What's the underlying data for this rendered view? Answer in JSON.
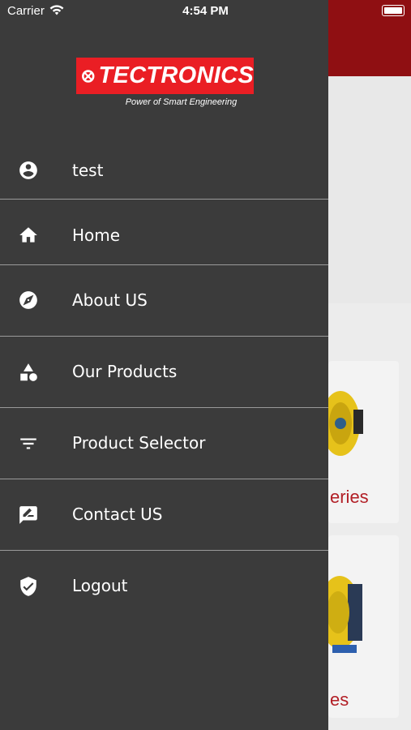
{
  "status_bar": {
    "carrier": "Carrier",
    "time": "4:54 PM",
    "wifi_icon": "wifi-icon",
    "battery_icon": "battery-icon"
  },
  "drawer": {
    "logo": {
      "brand": "TECTRONICS",
      "tagline": "Power of Smart Engineering",
      "brand_color": "#ea1e24"
    },
    "items": [
      {
        "label": "test",
        "icon": "account-circle-icon"
      },
      {
        "label": "Home",
        "icon": "home-icon"
      },
      {
        "label": "About US",
        "icon": "compass-icon"
      },
      {
        "label": "Our Products",
        "icon": "shapes-icon"
      },
      {
        "label": "Product Selector",
        "icon": "filter-icon"
      },
      {
        "label": "Contact US",
        "icon": "feedback-icon"
      },
      {
        "label": "Logout",
        "icon": "shield-check-icon"
      }
    ],
    "background_color": "#3b3b3b"
  },
  "background": {
    "header_color": "#8f0f12",
    "card1_text_fragment": "eries",
    "card2_text_fragment": "es",
    "accent_text_color": "#b21f26"
  }
}
